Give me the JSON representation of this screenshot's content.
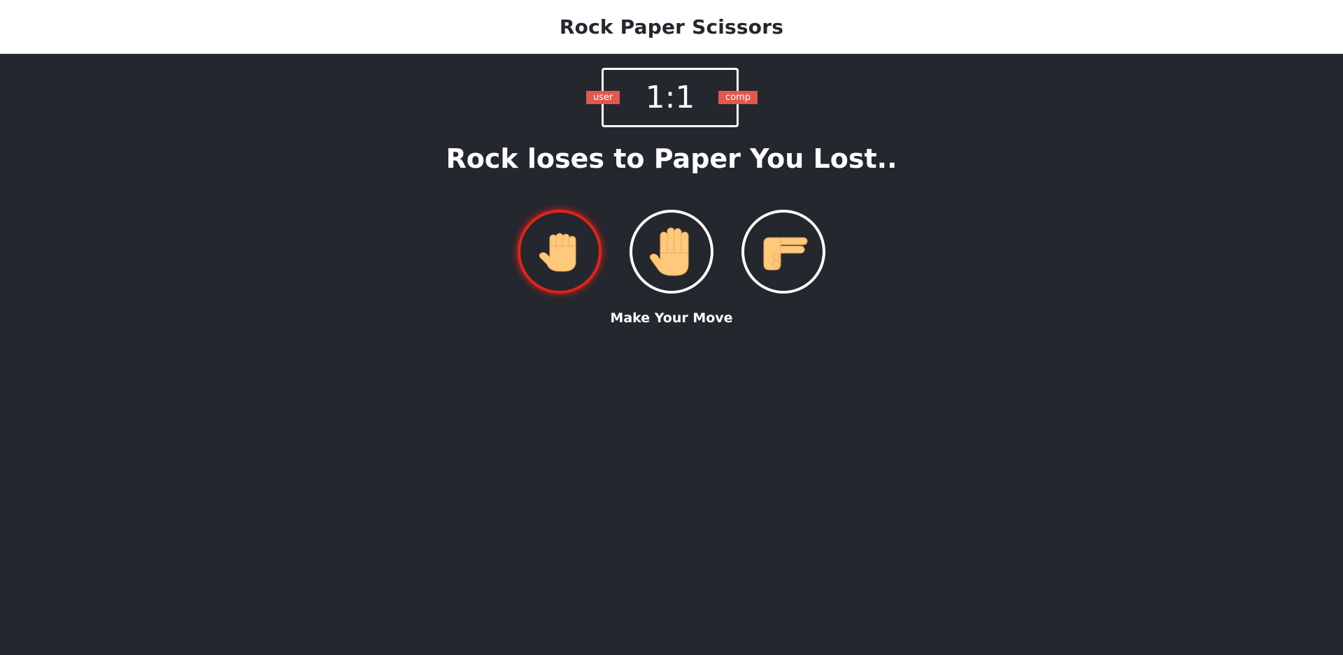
{
  "header": {
    "title": "Rock Paper Scissors"
  },
  "scoreboard": {
    "score": "1:1",
    "user_label": "user",
    "comp_label": "comp"
  },
  "result": {
    "message": "Rock loses to Paper You Lost.."
  },
  "choices": [
    {
      "name": "rock",
      "icon": "fist-icon",
      "state": "lost"
    },
    {
      "name": "paper",
      "icon": "open-hand-icon"
    },
    {
      "name": "scissors",
      "icon": "scissors-hand-icon"
    }
  ],
  "prompt": {
    "text": "Make Your Move"
  },
  "colors": {
    "background": "#24272E",
    "header_bg": "#FFFFFF",
    "badge": "#E2584D",
    "lose_glow": "#E2231A",
    "skin": "#FFC97C"
  }
}
